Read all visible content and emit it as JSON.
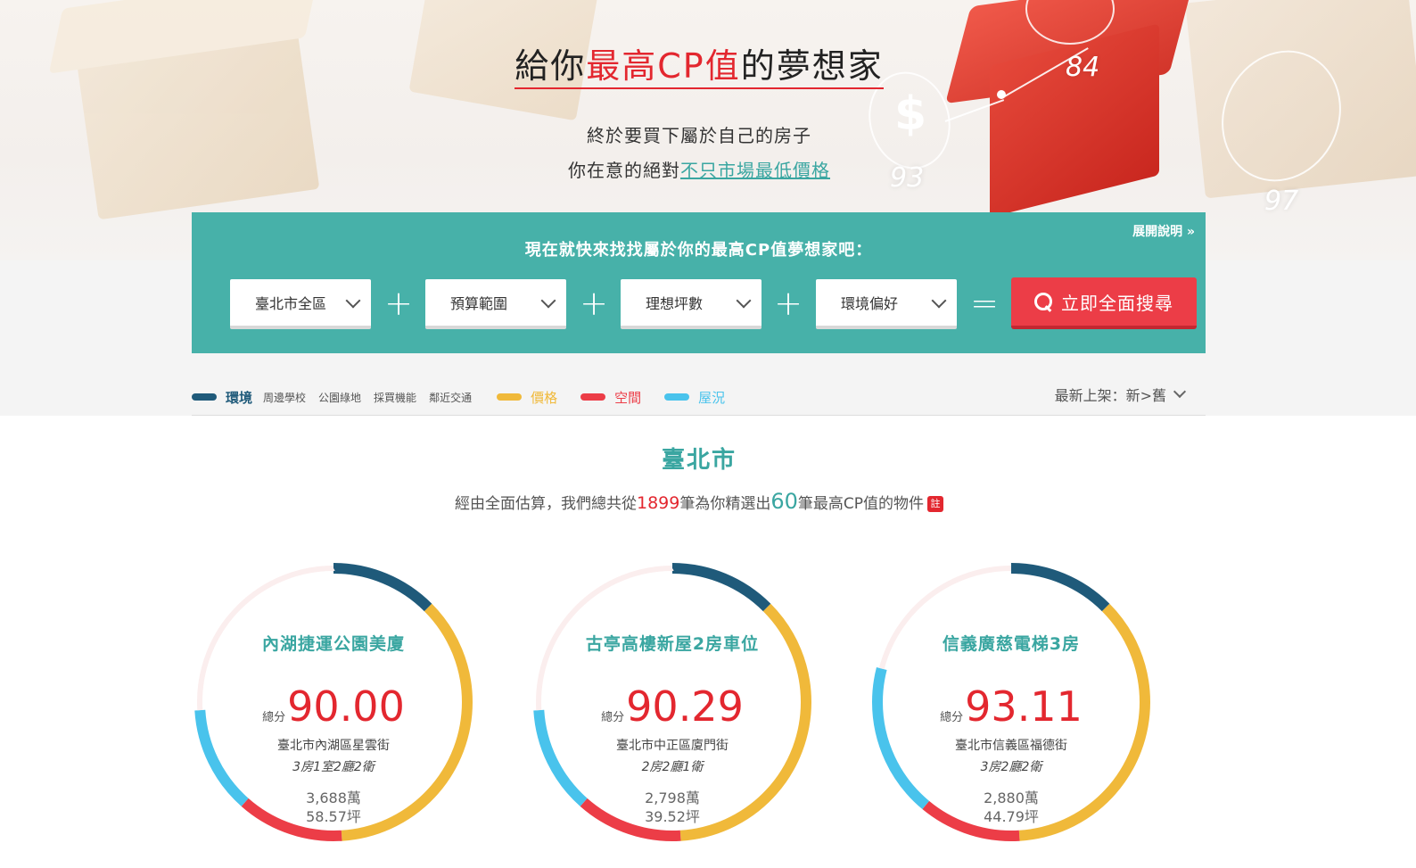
{
  "colors": {
    "teal": "#47b1a9",
    "accent_red": "#ec3d47",
    "env": "#1f5a7a",
    "price": "#f0b93a",
    "space": "#ec3d47",
    "condition": "#49c3ec"
  },
  "hero": {
    "title_pre": "給你",
    "title_highlight": "最高CP值",
    "title_post": "的夢想家",
    "sub1": "終於要買下屬於自己的房子",
    "sub2_pre": "你在意的絕對",
    "sub2_link": "不只市場最低價格",
    "halo_numbers": [
      "93",
      "84",
      "97"
    ]
  },
  "search": {
    "title": "現在就快來找找屬於你的最高CP值夢想家吧：",
    "expand_label": "展開說明",
    "district": "臺北市全區",
    "budget": "預算範圍",
    "area": "理想坪數",
    "env": "環境偏好",
    "plus": "+",
    "equals": "=",
    "button_label": "立即全面搜尋"
  },
  "legend": {
    "env_label": "環境",
    "env_subs": [
      "周邊學校",
      "公園綠地",
      "採買機能",
      "鄰近交通"
    ],
    "price_label": "價格",
    "space_label": "空間",
    "condition_label": "屋況",
    "sort_label": "最新上架：新>舊"
  },
  "results": {
    "city": "臺北市",
    "summary_pre": "經由全面估算，我們總共從",
    "total": "1899",
    "summary_mid": "筆為你精選出",
    "selected": "60",
    "summary_post": "筆最高CP值的物件",
    "note_badge": "註"
  },
  "listings": [
    {
      "name": "內湖捷運公園美廈",
      "score_label": "總分",
      "score": "90.00",
      "address": "臺北市內湖區星雲街",
      "layout": "3房1室2廳2衛",
      "price": "3,688萬",
      "area": "58.57坪",
      "segments": [
        {
          "factor": "env",
          "share": 0.125
        },
        {
          "factor": "price",
          "share": 0.365
        },
        {
          "factor": "space",
          "share": 0.125
        },
        {
          "factor": "condition",
          "share": 0.125
        },
        {
          "factor": "empty",
          "share": 0.26
        }
      ]
    },
    {
      "name": "古亭高樓新屋2房車位",
      "score_label": "總分",
      "score": "90.29",
      "address": "臺北市中正區廈門街",
      "layout": "2房2廳1衛",
      "price": "2,798萬",
      "area": "39.52坪",
      "segments": [
        {
          "factor": "env",
          "share": 0.125
        },
        {
          "factor": "price",
          "share": 0.365
        },
        {
          "factor": "space",
          "share": 0.125
        },
        {
          "factor": "condition",
          "share": 0.125
        },
        {
          "factor": "empty",
          "share": 0.26
        }
      ]
    },
    {
      "name": "信義廣慈電梯3房",
      "score_label": "總分",
      "score": "93.11",
      "address": "臺北市信義區福德街",
      "layout": "3房2廳2衛",
      "price": "2,880萬",
      "area": "44.79坪",
      "segments": [
        {
          "factor": "env",
          "share": 0.125
        },
        {
          "factor": "price",
          "share": 0.365
        },
        {
          "factor": "space",
          "share": 0.12
        },
        {
          "factor": "condition",
          "share": 0.18
        },
        {
          "factor": "empty",
          "share": 0.21
        }
      ]
    }
  ]
}
